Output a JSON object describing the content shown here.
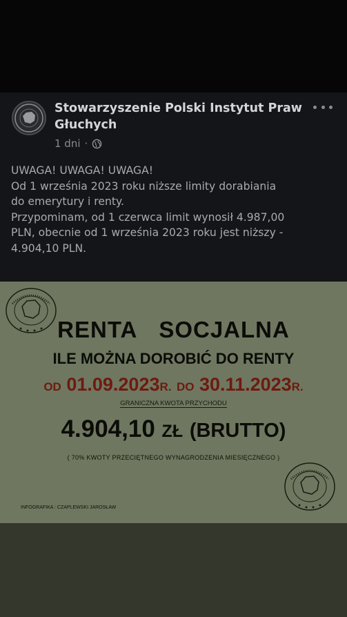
{
  "post": {
    "page_name": "Stowarzyszenie Polski Instytut Praw Głuchych",
    "time": "1 dni",
    "separator": "·",
    "privacy_icon": "globe-icon",
    "more_icon": "more-options-icon",
    "text_lines": [
      "UWAGA! UWAGA! UWAGA!",
      "Od 1 września 2023 roku niższe limity dorabiania",
      "do emerytury i renty.",
      "Przypominam, od 1 czerwca limit wynosił 4.987,00",
      "PLN, obecnie od 1 września 2023 roku jest niższy -",
      "4.904,10 PLN."
    ]
  },
  "infographic": {
    "title": "RENTA SOCJALNA",
    "subtitle": "ILE MOŻNA DOROBIĆ DO RENTY",
    "dates": {
      "from_word": "OD",
      "from_date": "01.09.2023",
      "from_suffix": "R.",
      "to_word": "DO",
      "to_date": "30.11.2023",
      "to_suffix": "R."
    },
    "limit_label": "GRANICZNA KWOTA PRZYCHODU",
    "amount": "4.904,10",
    "currency": "ZŁ",
    "gross": "(BRUTTO)",
    "note": "( 70% KWOTY PRZECIĘTNEGO WYNAGRODZENIA MIESIĘCZNEGO )",
    "credit": "INFOGRAFIKA : CZAPLEWSKI JAROSŁAW"
  },
  "colors": {
    "post_bg": "#141519",
    "infographic_bg": "#6f7760",
    "dates_color": "#6e1a10",
    "text_dark": "#0b0c08"
  }
}
